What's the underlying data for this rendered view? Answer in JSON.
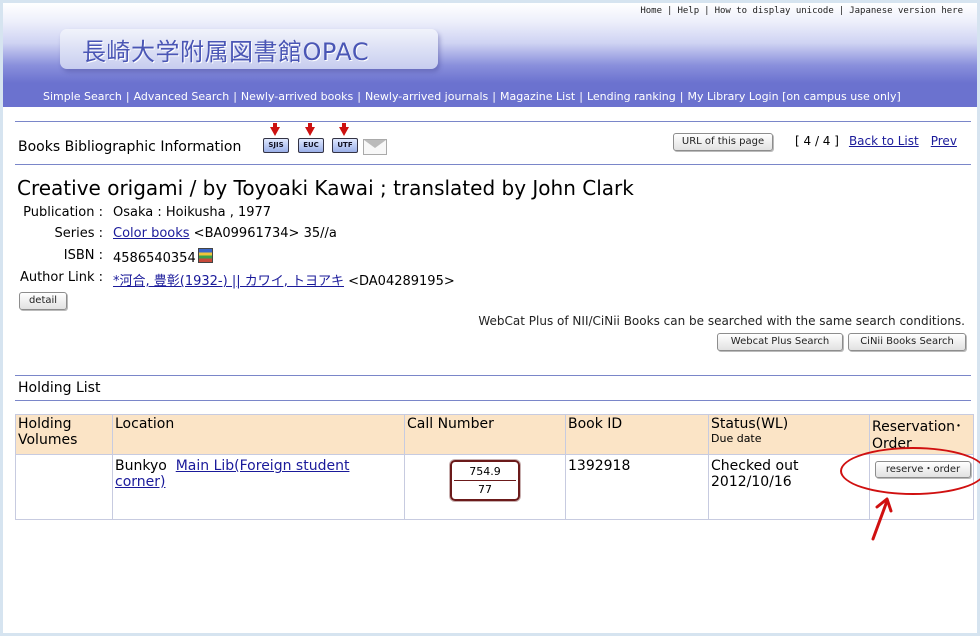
{
  "header": {
    "top_links": [
      "Home",
      "Help",
      "How to display unicode",
      "Japanese version here"
    ],
    "logo": "長崎大学附属図書館OPAC",
    "nav": [
      "Simple Search",
      "Advanced Search",
      "Newly-arrived books",
      "Newly-arrived journals",
      "Magazine List",
      "Lending ranking",
      "My Library Login [on campus use only]"
    ]
  },
  "biblio": {
    "heading": "Books Bibliographic Information",
    "icons": [
      "SJIS",
      "EUC",
      "UTF"
    ],
    "url_button": "URL of this page",
    "pager_count": "[ 4 / 4 ]",
    "back_link": "Back to List",
    "prev_link": "Prev"
  },
  "record": {
    "title": "Creative origami / by Toyoaki Kawai ; translated by John Clark",
    "publication_label": "Publication :",
    "publication_value": "Osaka : Hoikusha , 1977",
    "series_label": "Series :",
    "series_link": "Color books",
    "series_rest": " <BA09961734> 35//a",
    "isbn_label": "ISBN :",
    "isbn_value": "4586540354",
    "author_label": "Author Link :",
    "author_link": "*河合, 豊彰(1932-) || カワイ, トヨアキ",
    "author_rest": " <DA04289195>",
    "detail_button": "detail",
    "webcat_note": "WebCat Plus of NII/CiNii Books can be searched with the same search conditions.",
    "webcat_button": "Webcat Plus Search",
    "cinii_button": "CiNii Books Search"
  },
  "holdings": {
    "heading": "Holding List",
    "columns": {
      "volumes": "Holding Volumes",
      "location": "Location",
      "call_number": "Call Number",
      "book_id": "Book ID",
      "status": "Status(WL)",
      "due": "Due date",
      "reservation": "Reservation･Order"
    },
    "row": {
      "volumes": "",
      "campus": "Bunkyo",
      "location_link": "Main Lib(Foreign student corner)",
      "call_line1": "754.9",
      "call_line2": "77",
      "book_id": "1392918",
      "status": "Checked out",
      "due": "2012/10/16",
      "reserve_button": "reserve・order"
    }
  },
  "colors": {
    "header_band": "#6b72cf",
    "table_header": "#fbe4c6",
    "link": "#1a1a9a",
    "annotation": "#d01010"
  }
}
